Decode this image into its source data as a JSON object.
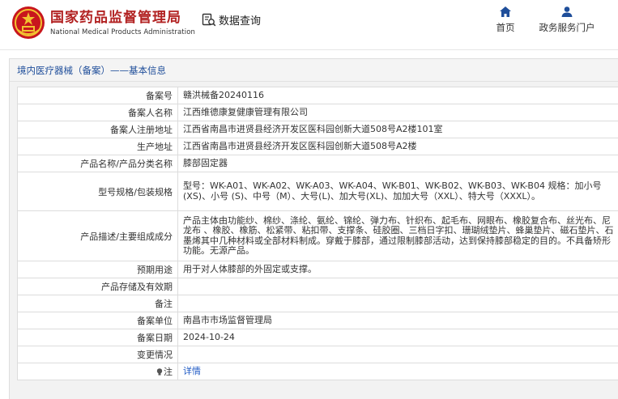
{
  "header": {
    "org_cn": "国家药品监督管理局",
    "org_en": "National Medical Products Administration",
    "query_label": "数据查询",
    "nav": [
      {
        "label": "首页",
        "icon": "home-icon"
      },
      {
        "label": "政务服务门户",
        "icon": "user-icon"
      }
    ]
  },
  "panel": {
    "title_main": "境内医疗器械（备案）",
    "title_sep": "——",
    "title_sub": "基本信息"
  },
  "rows": [
    {
      "label": "备案号",
      "value": "赣洪械备20240116"
    },
    {
      "label": "备案人名称",
      "value": "江西维德康复健康管理有限公司"
    },
    {
      "label": "备案人注册地址",
      "value": "江西省南昌市进贤县经济开发区医科园创新大道508号A2楼101室"
    },
    {
      "label": "生产地址",
      "value": "江西省南昌市进贤县经济开发区医科园创新大道508号A2楼"
    },
    {
      "label": "产品名称/产品分类名称",
      "value": "膝部固定器"
    },
    {
      "label": "型号规格/包装规格",
      "value": "型号：WK-A01、WK-A02、WK-A03、WK-A04、WK-B01、WK-B02、WK-B03、WK-B04 规格：加小号 (XS)、小号 (S)、中号（M）、大号(L)、加大号(XL)、加加大号（XXL）、特大号（XXXL）。"
    },
    {
      "label": "产品描述/主要组成成分",
      "value": "产品主体由功能纱、棉纱、涤纶、氨纶、锦纶、弹力布、针织布、起毛布、网眼布、橡胶复合布、丝光布、尼龙布 、橡胶、橡筋、松紧带、粘扣带、支撑条、硅胶圈、三档日字扣、珊瑚绒垫片、蜂巢垫片、磁石垫片、石墨烯其中几种材料或全部材料制成。穿戴于膝部，通过限制膝部活动，达到保持膝部稳定的目的。不具备矫形功能。无源产品。"
    },
    {
      "label": "预期用途",
      "value": "用于对人体膝部的外固定或支撑。"
    },
    {
      "label": "产品存储及有效期",
      "value": ""
    },
    {
      "label": "备注",
      "value": ""
    },
    {
      "label": "备案单位",
      "value": "南昌市市场监督管理局"
    },
    {
      "label": "备案日期",
      "value": "2024-10-24"
    },
    {
      "label": "变更情况",
      "value": ""
    },
    {
      "label": "注",
      "value": "详情"
    }
  ],
  "colors": {
    "brand_red": "#b22222",
    "title_blue": "#1f4e9a",
    "link_blue": "#1f5ac4",
    "nav_blue": "#1f4e9a"
  }
}
